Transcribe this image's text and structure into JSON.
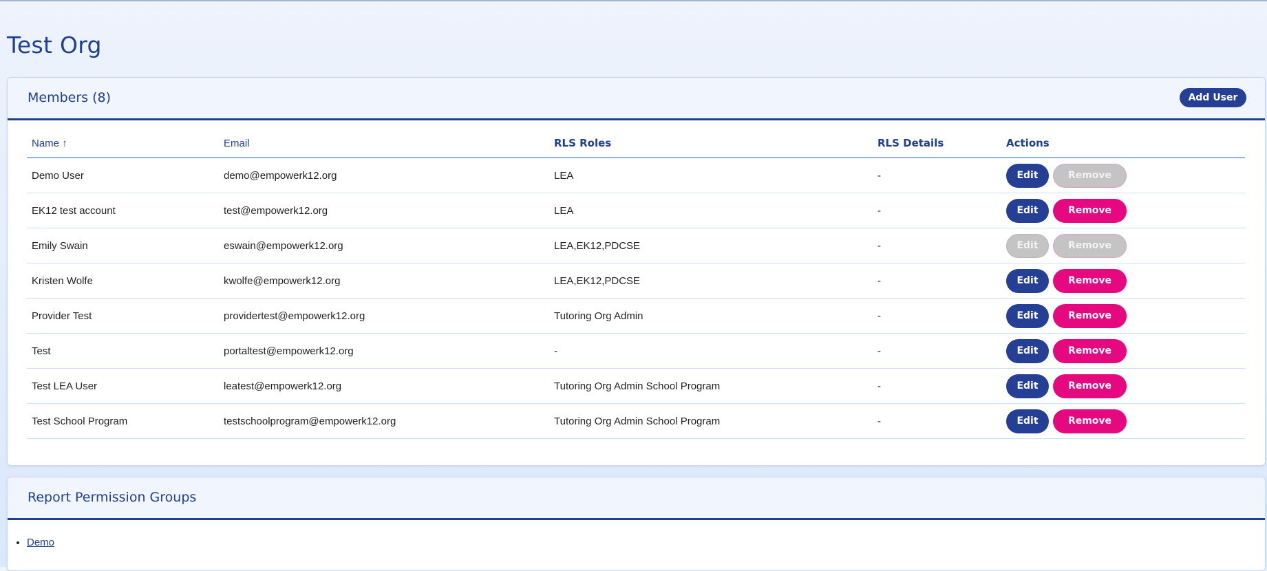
{
  "page": {
    "title": "Test Org"
  },
  "members": {
    "title": "Members (8)",
    "add_user_label": "Add User",
    "columns": {
      "name": "Name ↑",
      "email": "Email",
      "rls_roles": "RLS Roles",
      "rls_details": "RLS Details",
      "actions": "Actions"
    },
    "edit_label": "Edit",
    "remove_label": "Remove",
    "rows": [
      {
        "name": "Demo User",
        "email": "demo@empowerk12.org",
        "roles": "LEA",
        "details": "-",
        "edit_enabled": true,
        "remove_enabled": false
      },
      {
        "name": "EK12 test account",
        "email": "test@empowerk12.org",
        "roles": "LEA",
        "details": "-",
        "edit_enabled": true,
        "remove_enabled": true
      },
      {
        "name": "Emily Swain",
        "email": "eswain@empowerk12.org",
        "roles": "LEA,EK12,PDCSE",
        "details": "-",
        "edit_enabled": false,
        "remove_enabled": false
      },
      {
        "name": "Kristen Wolfe",
        "email": "kwolfe@empowerk12.org",
        "roles": "LEA,EK12,PDCSE",
        "details": "-",
        "edit_enabled": true,
        "remove_enabled": true
      },
      {
        "name": "Provider Test",
        "email": "providertest@empowerk12.org",
        "roles": "Tutoring Org Admin",
        "details": "-",
        "edit_enabled": true,
        "remove_enabled": true
      },
      {
        "name": "Test",
        "email": "portaltest@empowerk12.org",
        "roles": "-",
        "details": "-",
        "edit_enabled": true,
        "remove_enabled": true,
        "muted": true
      },
      {
        "name": "Test LEA User",
        "email": "leatest@empowerk12.org",
        "roles": "Tutoring Org Admin School Program",
        "details": "-",
        "edit_enabled": true,
        "remove_enabled": true
      },
      {
        "name": "Test School Program",
        "email": "testschoolprogram@empowerk12.org",
        "roles": "Tutoring Org Admin School Program",
        "details": "-",
        "edit_enabled": true,
        "remove_enabled": true
      }
    ]
  },
  "report_groups": {
    "title": "Report Permission Groups",
    "items": [
      {
        "label": "Demo"
      }
    ]
  },
  "colors": {
    "primary": "#243f94",
    "danger": "#e5087f",
    "disabled": "#c4c4c4",
    "heading": "#1f3f8f"
  }
}
